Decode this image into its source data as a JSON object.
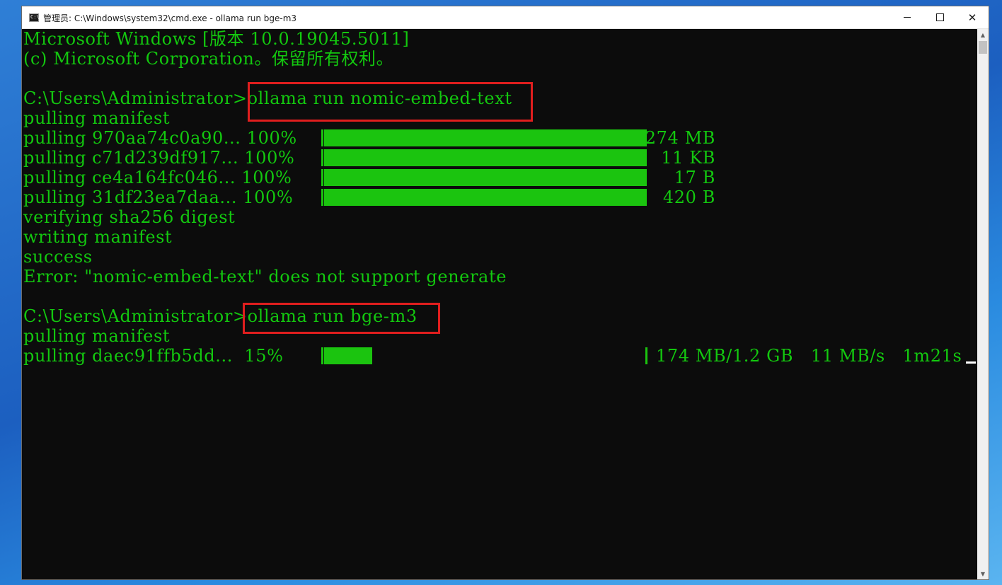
{
  "window": {
    "title": "管理员: C:\\Windows\\system32\\cmd.exe - ollama  run bge-m3",
    "icon": "cmd-icon",
    "controls": [
      "minimize-icon",
      "maximize-icon",
      "close-icon"
    ]
  },
  "console": {
    "lines": [
      "Microsoft Windows [版本 10.0.19045.5011]",
      "(c) Microsoft Corporation。保留所有权利。",
      "",
      "C:\\Users\\Administrator>ollama run nomic-embed-text",
      "pulling manifest",
      "pulling 970aa74c0a90... 100%",
      "pulling c71d239df917... 100%",
      "pulling ce4a164fc046... 100%",
      "pulling 31df23ea7daa... 100%",
      "verifying sha256 digest",
      "writing manifest",
      "success",
      "Error: \"nomic-embed-text\" does not support generate",
      "",
      "C:\\Users\\Administrator>ollama run bge-m3",
      "pulling manifest",
      "pulling daec91ffb5dd...  15%"
    ],
    "progress": [
      {
        "label": "970aa74c0a90",
        "fraction": 1.0,
        "size": "274 MB"
      },
      {
        "label": "c71d239df917",
        "fraction": 1.0,
        "size": "11 KB"
      },
      {
        "label": "ce4a164fc046",
        "fraction": 1.0,
        "size": "17 B"
      },
      {
        "label": "31df23ea7daa",
        "fraction": 1.0,
        "size": "420 B"
      },
      {
        "label": "daec91ffb5dd",
        "fraction": 0.15,
        "size": "174 MB/1.2 GB   11 MB/s   1m21s"
      }
    ],
    "highlighted_commands": [
      "ollama run nomic-embed-text",
      "ollama run bge-m3"
    ],
    "colors": {
      "text": "#13c80f",
      "background": "#0c0c0c",
      "highlight": "#e01e1e"
    }
  }
}
